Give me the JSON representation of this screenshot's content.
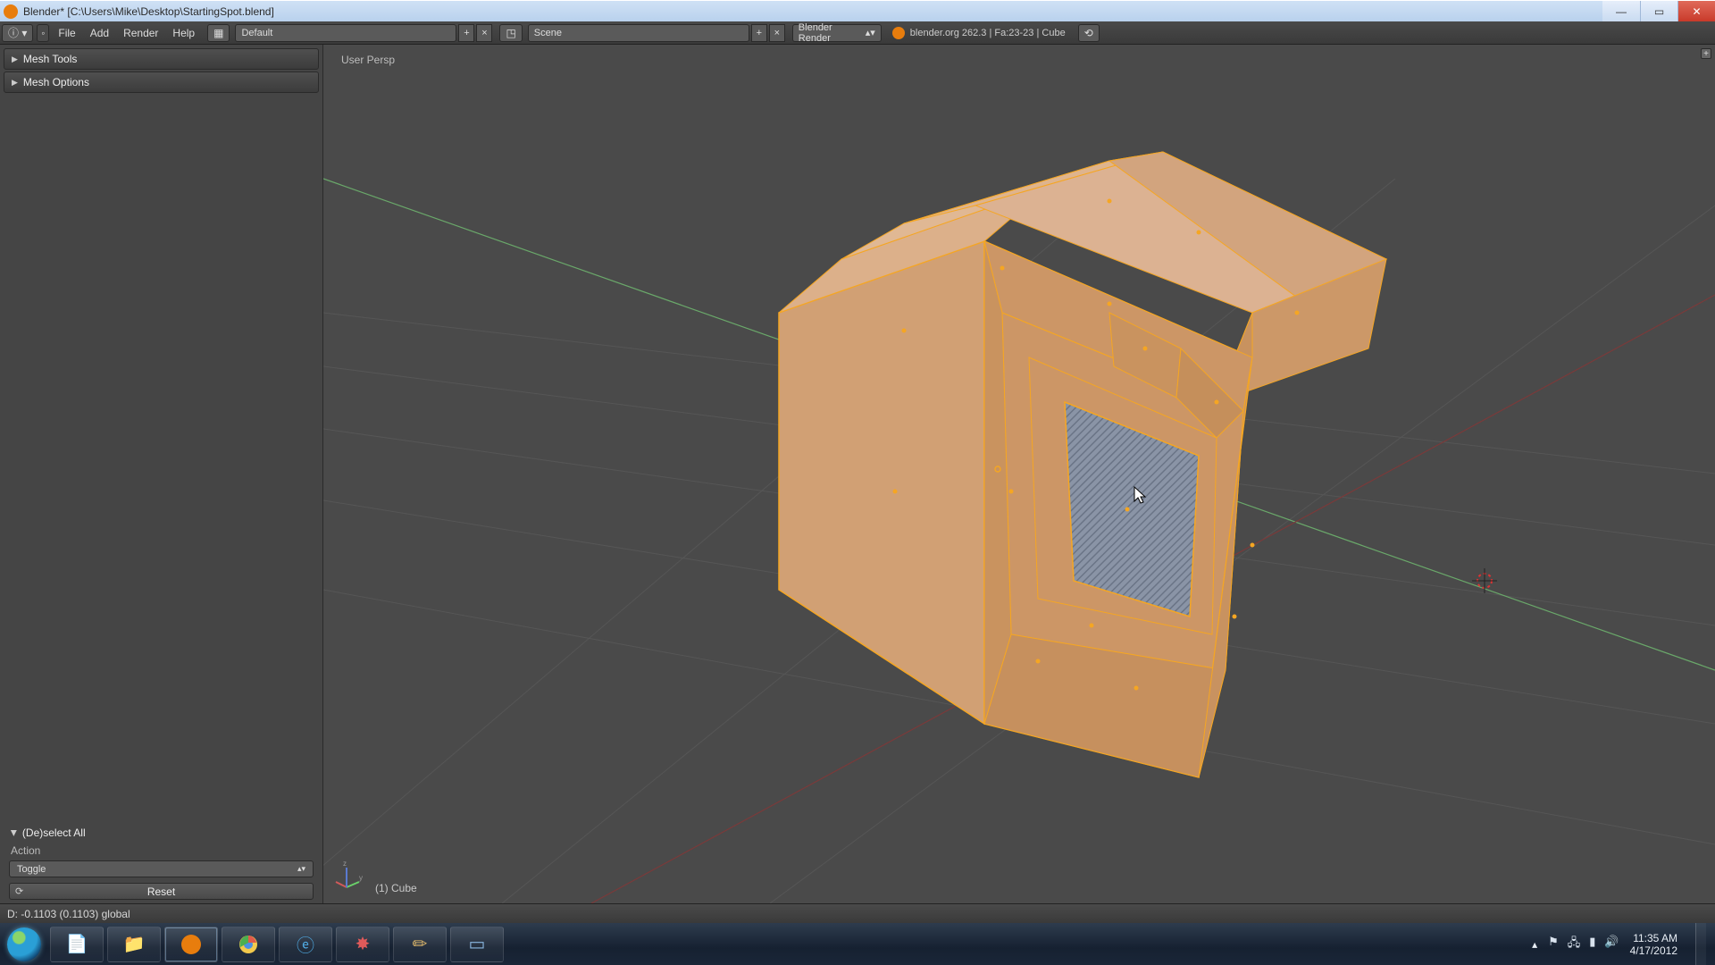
{
  "titlebar": {
    "app_name": "Blender* [C:\\Users\\Mike\\Desktop\\StartingSpot.blend]"
  },
  "menu": {
    "file": "File",
    "add": "Add",
    "render": "Render",
    "help": "Help"
  },
  "header": {
    "screen_layout": "Default",
    "scene_name": "Scene",
    "render_engine": "Blender Render",
    "status": "blender.org 262.3 | Fa:23-23 | Cube"
  },
  "sidebar": {
    "mesh_tools": "Mesh Tools",
    "mesh_options": "Mesh Options",
    "operator": {
      "title": "(De)select All",
      "action_label": "Action",
      "action_value": "Toggle",
      "reset": "Reset"
    }
  },
  "viewport": {
    "projection": "User Persp",
    "object_name": "(1) Cube"
  },
  "statusbar": {
    "text": "D: -0.1103 (0.1103) global"
  },
  "tray": {
    "time": "11:35 AM",
    "date": "4/17/2012"
  }
}
